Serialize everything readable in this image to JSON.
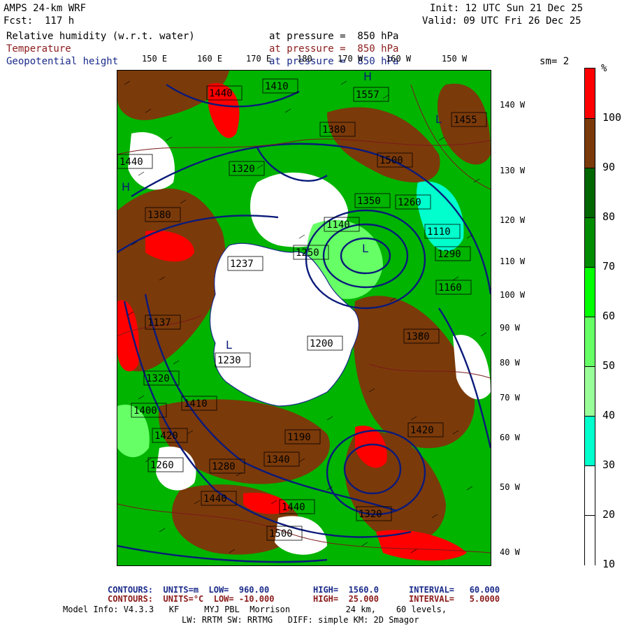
{
  "header": {
    "model": "AMPS 24-km WRF",
    "forecast": "Fcst:  117 h",
    "init": "Init: 12 UTC Sun 21 Dec 25",
    "valid": "Valid: 09 UTC Fri 26 Dec 25",
    "field1_name": "Relative humidity (w.r.t. water)",
    "field1_level": "at pressure =  850 hPa",
    "field2_name": "Temperature",
    "field2_level": "at pressure =  850 hPa",
    "field3_name": "Geopotential height",
    "field3_level": "at pressure =  850 hPa",
    "smoothing": "sm= 2"
  },
  "map": {
    "lon_labels": [
      "150 E",
      "160 E",
      "170 E",
      "180",
      "170 W",
      "160 W",
      "150 W"
    ],
    "lat_labels": [
      "140 W",
      "130 W",
      "120 W",
      "110 W",
      "100 W",
      "90 W",
      "80 W",
      "70 W",
      "60 W",
      "50 W",
      "40 W"
    ],
    "height_labels": [
      "1440",
      "1410",
      "1557",
      "1455",
      "1500",
      "1380",
      "1320",
      "1350",
      "1260",
      "1140",
      "1250",
      "1110",
      "1237",
      "1290",
      "1200",
      "1230",
      "1160",
      "1137",
      "1320",
      "1440",
      "1380",
      "1400",
      "1410",
      "1420",
      "1380",
      "1190",
      "1440",
      "1500",
      "1320",
      "1440",
      "1260",
      "1340",
      "1280",
      "1420"
    ],
    "high_low": [
      "H",
      "L",
      "L",
      "L",
      "H"
    ],
    "colors": {
      "land": "#ffffff",
      "coast": "#1a2a8a",
      "height_contour": "#0a1a7a",
      "temp_contour": "#7a1a1a"
    }
  },
  "colorbar": {
    "unit": "%",
    "labels": [
      "100",
      "90",
      "80",
      "70",
      "60",
      "50",
      "40",
      "30",
      "20",
      "10"
    ],
    "colors": [
      "#ff0000",
      "#7b3a0a",
      "#006600",
      "#008c00",
      "#00ff00",
      "#66ff66",
      "#99ff99",
      "#00ffcc",
      "#ffffff",
      "#ffffff"
    ]
  },
  "footer": {
    "line1_label": "CONTOURS:  UNITS=m  LOW=  960.00",
    "line1_high": "HIGH=  1560.0",
    "line1_interval": "INTERVAL=   60.000",
    "line2_label": "CONTOURS:  UNITS=°C  LOW= -10.000",
    "line2_high": "HIGH=  25.000",
    "line2_interval": "INTERVAL=   5.0000",
    "line3": "Model Info: V4.3.3   KF     MYJ PBL  Morrison           24 km,    60 levels,",
    "line4": "LW: RRTM SW: RRTMG   DIFF: simple KM: 2D Smagor"
  }
}
